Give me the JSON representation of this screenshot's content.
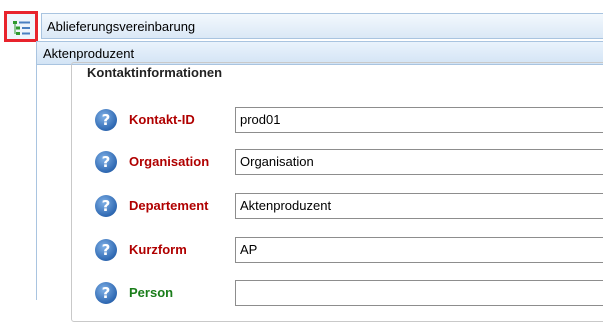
{
  "header": {
    "tree_icon": "tree-list-icon",
    "tab_label": "Ablieferungsvereinbarung"
  },
  "section": {
    "tab_label": "Aktenproduzent"
  },
  "kontakt": {
    "legend": "Kontaktinformationen",
    "fields": [
      {
        "label": "Kontakt-ID",
        "value": "prod01",
        "required": true
      },
      {
        "label": "Organisation",
        "value": "Organisation",
        "required": true
      },
      {
        "label": "Departement",
        "value": "Aktenproduzent",
        "required": true
      },
      {
        "label": "Kurzform",
        "value": "AP",
        "required": true
      },
      {
        "label": "Person",
        "value": "",
        "required": false
      }
    ],
    "help_glyph": "?",
    "help_icon": "help-icon"
  },
  "colors": {
    "required_label": "#b00000",
    "optional_label": "#1a7d1a",
    "highlight_border": "#e8232c",
    "tab_border": "#a9c4e0"
  }
}
